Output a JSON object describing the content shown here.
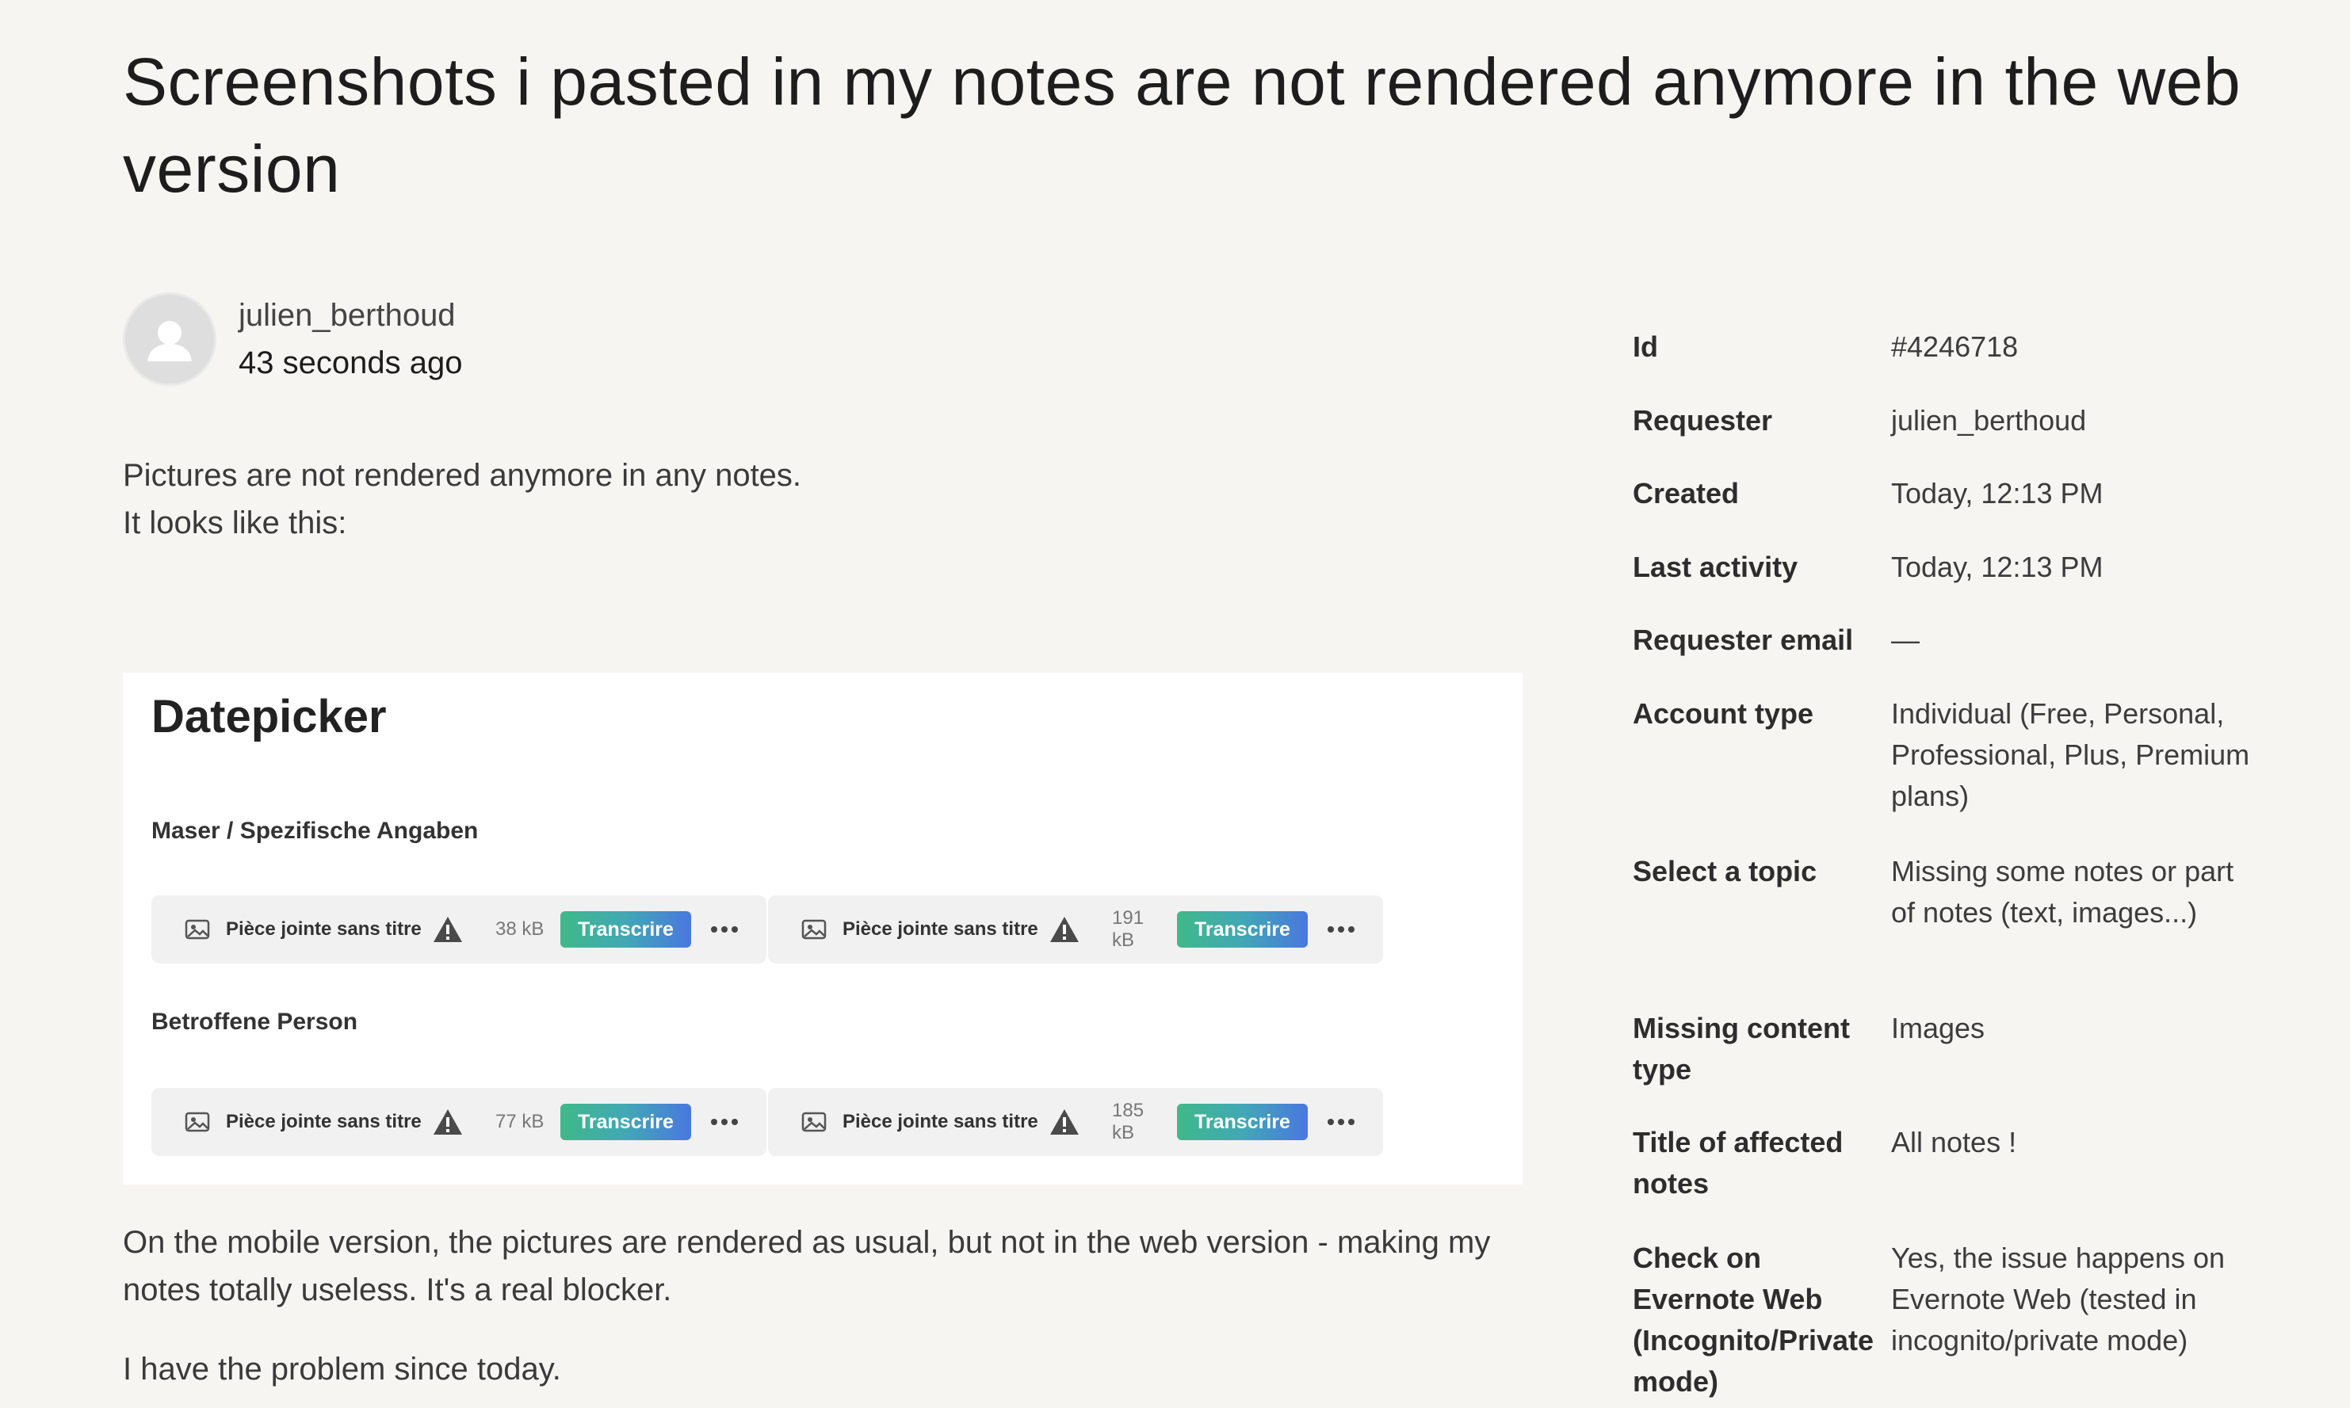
{
  "title": "Screenshots i pasted in my notes are not rendered anymore in the web version",
  "author": {
    "name": "julien_berthoud",
    "time": "43 seconds ago"
  },
  "body": {
    "p1_line1": "Pictures are not rendered anymore in any notes.",
    "p1_line2": "It looks like this:",
    "p2": "On the mobile version, the pictures are rendered as usual, but not in the web version - making my notes totally useless. It's a real blocker.",
    "p3": "I have the problem since today."
  },
  "embed": {
    "title": "Datepicker",
    "section1": "Maser / Spezifische Angaben",
    "section2": "Betroffene Person",
    "attachments": [
      {
        "name": "Pièce jointe sans titre",
        "size": "38 kB",
        "action": "Transcrire"
      },
      {
        "name": "Pièce jointe sans titre",
        "size": "191 kB",
        "action": "Transcrire"
      },
      {
        "name": "Pièce jointe sans titre",
        "size": "77 kB",
        "action": "Transcrire"
      },
      {
        "name": "Pièce jointe sans titre",
        "size": "185 kB",
        "action": "Transcrire"
      }
    ]
  },
  "details": [
    {
      "label": "Id",
      "value": "#4246718"
    },
    {
      "label": "Requester",
      "value": "julien_berthoud"
    },
    {
      "label": "Created",
      "value": "Today, 12:13 PM"
    },
    {
      "label": "Last activity",
      "value": "Today, 12:13 PM"
    },
    {
      "label": "Requester email",
      "value": "—"
    },
    {
      "label": "Account type",
      "value": "Individual (Free, Personal, Professional, Plus, Premium plans)"
    },
    {
      "label": "Select a topic",
      "value": "Missing some notes or part of notes (text, images...)"
    },
    {
      "label": "Missing content type",
      "value": "Images"
    },
    {
      "label": "Title of affected notes",
      "value": "All notes !"
    },
    {
      "label": "Check on Evernote Web (Incognito/Private mode)",
      "value": "Yes, the issue happens on Evernote Web (tested in incognito/private mode)"
    }
  ],
  "icons": {
    "avatar": "user-avatar-icon",
    "image": "image-icon",
    "warning": "warning-icon",
    "more": "more-icon"
  },
  "colors": {
    "background": "#f7f5f1",
    "transcribe_start": "#3fb98a",
    "transcribe_end": "#4a77e0"
  }
}
